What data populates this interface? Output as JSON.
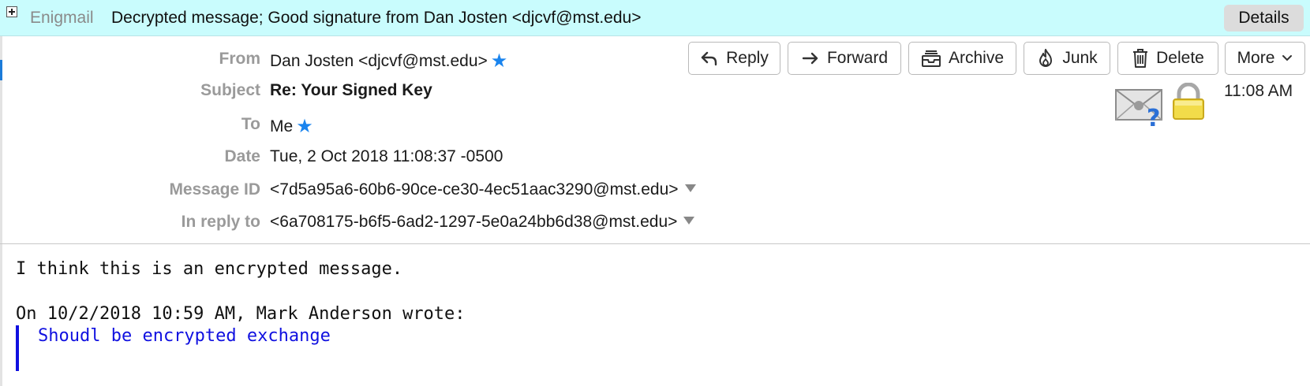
{
  "enigmail": {
    "label": "Enigmail",
    "status": "Decrypted message; Good signature from Dan Josten <djcvf@mst.edu>",
    "details_label": "Details"
  },
  "headers": {
    "from": {
      "label": "From",
      "value": "Dan Josten <djcvf@mst.edu>"
    },
    "subject": {
      "label": "Subject",
      "value": "Re: Your Signed Key"
    },
    "to": {
      "label": "To",
      "value": "Me"
    },
    "date": {
      "label": "Date",
      "value": "Tue, 2 Oct 2018 11:08:37 -0500"
    },
    "message_id": {
      "label": "Message ID",
      "value": "<7d5a95a6-60b6-90ce-ce30-4ec51aac3290@mst.edu>"
    },
    "in_reply_to": {
      "label": "In reply to",
      "value": "<6a708175-b6f5-6ad2-1297-5e0a24bb6d38@mst.edu>"
    }
  },
  "toolbar": {
    "reply": "Reply",
    "forward": "Forward",
    "archive": "Archive",
    "junk": "Junk",
    "delete": "Delete",
    "more": "More"
  },
  "time": "11:08 AM",
  "message": {
    "line1": "I think this is an encrypted message.",
    "attribution": "On 10/2/2018 10:59 AM, Mark Anderson wrote:",
    "quoted": "Shoudl be encrypted exchange"
  },
  "colors": {
    "enigmail_bar": "#c9fcfd",
    "star": "#1a84ee",
    "quote": "#1010e0"
  }
}
